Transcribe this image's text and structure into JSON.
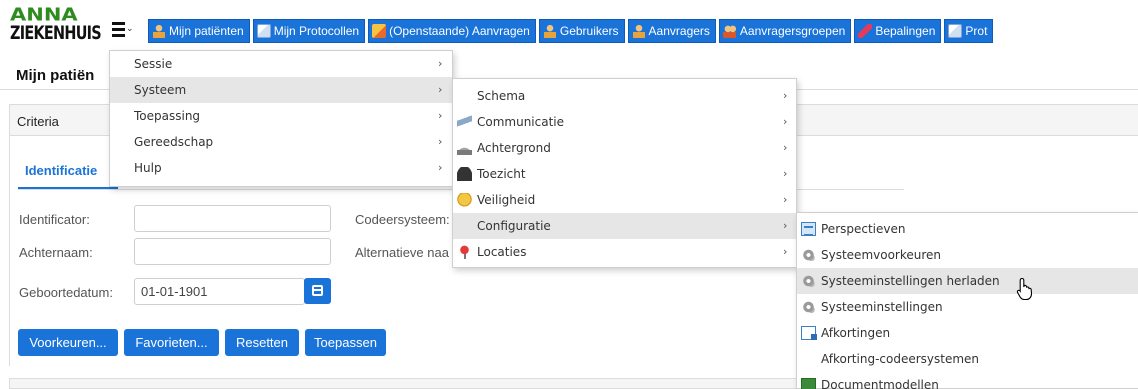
{
  "logo": {
    "line1": "ANNA",
    "line2": "ZIEKENHUIS"
  },
  "nav_tabs": [
    {
      "label": "Mijn patiënten",
      "icon": "person-icon"
    },
    {
      "label": "Mijn Protocollen",
      "icon": "pages-icon"
    },
    {
      "label": "(Openstaande) Aanvragen",
      "icon": "pencil-icon"
    },
    {
      "label": "Gebruikers",
      "icon": "person-icon"
    },
    {
      "label": "Aanvragers",
      "icon": "person-icon"
    },
    {
      "label": "Aanvragersgroepen",
      "icon": "people-icon"
    },
    {
      "label": "Bepalingen",
      "icon": "pen-icon"
    },
    {
      "label": "Prot",
      "icon": "pages-icon"
    }
  ],
  "page": {
    "title": "Mijn patiën"
  },
  "criteria": {
    "label": "Criteria",
    "tab": "Identificatie",
    "fields": {
      "identificator_label": "Identificator:",
      "achternaam_label": "Achternaam:",
      "geboortedatum_label": "Geboortedatum:",
      "geboortedatum_value": "01-01-1901",
      "codeersysteem_label": "Codeersysteem:",
      "alternatieve_label": "Alternatieve naa"
    },
    "buttons": {
      "voorkeuren": "Voorkeuren...",
      "favorieten": "Favorieten...",
      "resetten": "Resetten",
      "toepassen": "Toepassen"
    }
  },
  "menu_main": [
    {
      "label": "Sessie"
    },
    {
      "label": "Systeem",
      "highlighted": true
    },
    {
      "label": "Toepassing"
    },
    {
      "label": "Gereedschap"
    },
    {
      "label": "Hulp"
    }
  ],
  "menu_systeem": [
    {
      "label": "Schema",
      "icon": ""
    },
    {
      "label": "Communicatie",
      "icon": "send-icon"
    },
    {
      "label": "Achtergrond",
      "icon": "mountain-icon"
    },
    {
      "label": "Toezicht",
      "icon": "helmet-icon"
    },
    {
      "label": "Veiligheid",
      "icon": "shield-icon"
    },
    {
      "label": "Configuratie",
      "icon": "",
      "highlighted": true
    },
    {
      "label": "Locaties",
      "icon": "pin-icon"
    }
  ],
  "menu_configuratie": [
    {
      "label": "Perspectieven",
      "icon": "grid-icon"
    },
    {
      "label": "Systeemvoorkeuren",
      "icon": "gear-icon"
    },
    {
      "label": "Systeeminstellingen herladen",
      "icon": "gear-icon",
      "highlighted": true
    },
    {
      "label": "Systeeminstellingen",
      "icon": "gear-icon"
    },
    {
      "label": "Afkortingen",
      "icon": "document-icon"
    },
    {
      "label": "Afkorting-codeersystemen",
      "icon": ""
    },
    {
      "label": "Documentmodellen",
      "icon": "green-icon"
    }
  ],
  "colors": {
    "primary": "#1a73d9",
    "highlight": "#e6e6e6",
    "logo_green": "#2e8b1e"
  }
}
